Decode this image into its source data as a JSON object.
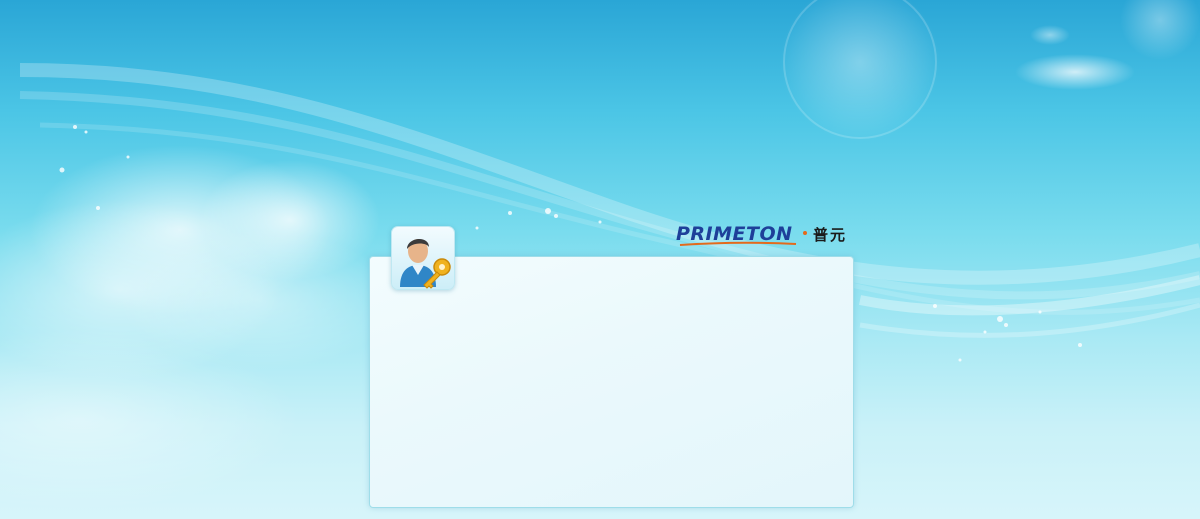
{
  "brand": {
    "name_en": "PRIMETON",
    "separator": "·",
    "name_cn": "普元",
    "primary_color": "#1e3f99",
    "accent_color": "#e36a1c"
  },
  "login_panel": {
    "icon": "user-key-icon"
  },
  "theme": {
    "background_sky_top": "#2aa6d6",
    "background_sky_bottom": "#d7f5fa",
    "panel_border": "#9fdde9"
  }
}
